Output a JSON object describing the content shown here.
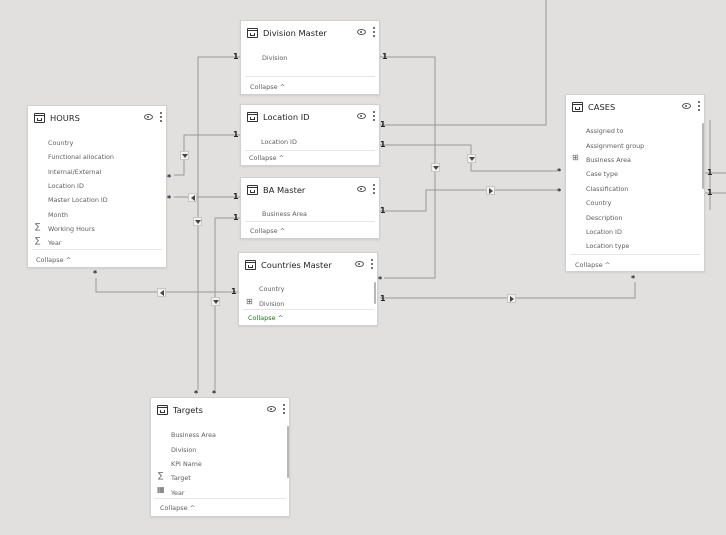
{
  "tables": {
    "division": {
      "title": "Division Master",
      "fields": [
        "Division"
      ],
      "collapse": "Collapse ^"
    },
    "location": {
      "title": "Location ID",
      "fields": [
        "Location ID"
      ],
      "collapse": "Collapse ^"
    },
    "ba": {
      "title": "BA Master",
      "fields": [
        "Business Area"
      ],
      "collapse": "Collapse ^"
    },
    "countries": {
      "title": "Countries Master",
      "fields": [
        "Country",
        "Division"
      ],
      "collapse": "Collapse ^"
    },
    "hours": {
      "title": "HOURS",
      "fields": [
        "Country",
        "Functional allocation",
        "Internal/External",
        "Location ID",
        "Master Location ID",
        "Month",
        "Working Hours",
        "Year"
      ],
      "collapse": "Collapse ^"
    },
    "cases": {
      "title": "CASES",
      "fields": [
        "Assigned to",
        "Assignment group",
        "Business Area",
        "Case type",
        "Classification",
        "Country",
        "Description",
        "Location ID",
        "Location type"
      ],
      "collapse": "Collapse ^"
    },
    "targets": {
      "title": "Targets",
      "fields": [
        "Business Area",
        "Division",
        "KPI Name",
        "Target",
        "Year"
      ],
      "collapse": "Collapse ^"
    }
  },
  "cardinality": {
    "one": "1",
    "many": "*"
  },
  "icons": {
    "table": "table-icon",
    "visibility": "eye-icon",
    "more": "more-options-icon",
    "sum": "sigma-icon",
    "calendar": "calendar-icon",
    "hierarchy": "hierarchy-icon",
    "filter_down": "filter-direction-down-icon",
    "filter_left": "filter-direction-left-icon",
    "filter_right": "filter-direction-right-icon"
  },
  "colors": {
    "canvas": "#e1e0df",
    "line": "#8a8886",
    "accent": "#107c10"
  }
}
